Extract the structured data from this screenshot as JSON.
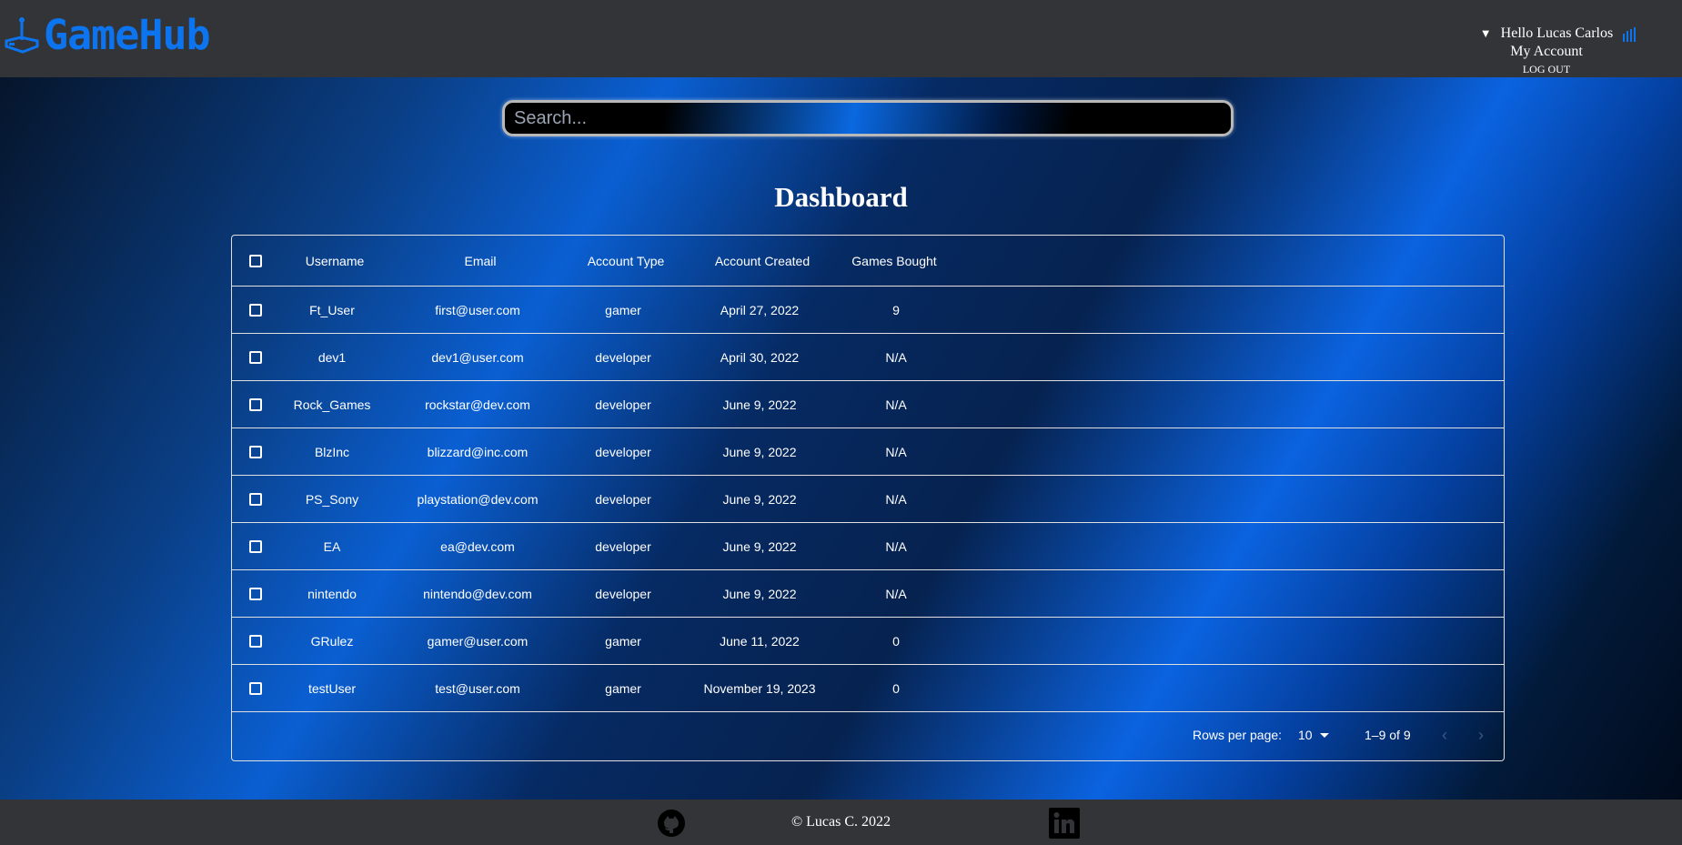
{
  "header": {
    "logo_text": "GameHub",
    "greeting": "Hello Lucas Carlos",
    "my_account": "My Account",
    "logout": "LOG OUT"
  },
  "search": {
    "placeholder": "Search..."
  },
  "page_title": "Dashboard",
  "table": {
    "columns": [
      "Username",
      "Email",
      "Account Type",
      "Account Created",
      "Games Bought"
    ],
    "rows": [
      {
        "username": "Ft_User",
        "email": "first@user.com",
        "type": "gamer",
        "created": "April 27, 2022",
        "games": "9"
      },
      {
        "username": "dev1",
        "email": "dev1@user.com",
        "type": "developer",
        "created": "April 30, 2022",
        "games": "N/A"
      },
      {
        "username": "Rock_Games",
        "email": "rockstar@dev.com",
        "type": "developer",
        "created": "June 9, 2022",
        "games": "N/A"
      },
      {
        "username": "BlzInc",
        "email": "blizzard@inc.com",
        "type": "developer",
        "created": "June 9, 2022",
        "games": "N/A"
      },
      {
        "username": "PS_Sony",
        "email": "playstation@dev.com",
        "type": "developer",
        "created": "June 9, 2022",
        "games": "N/A"
      },
      {
        "username": "EA",
        "email": "ea@dev.com",
        "type": "developer",
        "created": "June 9, 2022",
        "games": "N/A"
      },
      {
        "username": "nintendo",
        "email": "nintendo@dev.com",
        "type": "developer",
        "created": "June 9, 2022",
        "games": "N/A"
      },
      {
        "username": "GRulez",
        "email": "gamer@user.com",
        "type": "gamer",
        "created": "June 11, 2022",
        "games": "0"
      },
      {
        "username": "testUser",
        "email": "test@user.com",
        "type": "gamer",
        "created": "November 19, 2023",
        "games": "0"
      }
    ],
    "pagination": {
      "rows_per_page_label": "Rows per page:",
      "rows_per_page_value": "10",
      "range": "1–9 of 9"
    }
  },
  "footer": {
    "copyright": "© Lucas C. 2022"
  },
  "icons": {
    "logo": "joystick-icon",
    "stats": "bar-chart-icon",
    "github": "github-icon",
    "linkedin": "linkedin-icon",
    "prev": "chevron-left-icon",
    "next": "chevron-right-icon"
  },
  "colors": {
    "accent": "#0d74f0",
    "header_bg": "#323438"
  }
}
